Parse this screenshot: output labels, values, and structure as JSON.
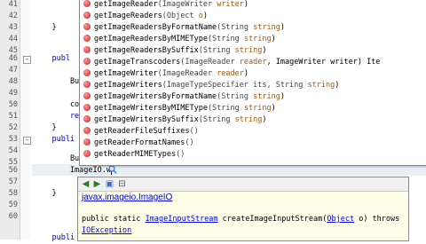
{
  "editor": {
    "line_numbers": [
      "41",
      "42",
      "43",
      "44",
      "45",
      "46",
      "47",
      "48",
      "49",
      "50",
      "51",
      "52",
      "53",
      "54",
      "55",
      "56",
      "57",
      "58",
      "59",
      "60"
    ],
    "code_lines": [
      "",
      "",
      "    }",
      "",
      "",
      "    publ",
      "",
      "        Buff",
      "",
      "        comp",
      "        retu",
      "    }",
      "    publi",
      "",
      "        Buffe",
      "        ImageIO.w",
      "",
      "    }",
      "",
      ""
    ],
    "last_line_text": "    publi"
  },
  "completion": {
    "items": [
      {
        "name": "getImageReader",
        "params": "(ImageWriter ",
        "param_name": "writer",
        "tail": ")"
      },
      {
        "name": "getImageReaders",
        "params": "(Object ",
        "param_name": "o",
        "tail": ")"
      },
      {
        "name": "getImageReadersByFormatName",
        "params": "(String ",
        "param_name": "string",
        "tail": ")"
      },
      {
        "name": "getImageReadersByMIMEType",
        "params": "(String ",
        "param_name": "string",
        "tail": ")"
      },
      {
        "name": "getImageReadersBySuffix",
        "params": "(String ",
        "param_name": "string",
        "tail": ")"
      },
      {
        "name": "getImageTranscoders",
        "params": "(ImageReader ",
        "param_name": "reader",
        "tail": ", ImageWriter writer) Ite"
      },
      {
        "name": "getImageWriter",
        "params": "(ImageReader ",
        "param_name": "reader",
        "tail": ")"
      },
      {
        "name": "getImageWriters",
        "params": "(ImageTypeSpecifier its, String ",
        "param_name": "string",
        "tail": ")"
      },
      {
        "name": "getImageWritersByFormatName",
        "params": "(String ",
        "param_name": "string",
        "tail": ")"
      },
      {
        "name": "getImageWritersByMIMEType",
        "params": "(String ",
        "param_name": "string",
        "tail": ")"
      },
      {
        "name": "getImageWritersBySuffix",
        "params": "(String ",
        "param_name": "string",
        "tail": ")"
      },
      {
        "name": "getReaderFileSuffixes",
        "params": "()",
        "param_name": "",
        "tail": ""
      },
      {
        "name": "getReaderFormatNames",
        "params": "()",
        "param_name": "",
        "tail": ""
      },
      {
        "name": "getReaderMIMETypes",
        "params": "()",
        "param_name": "",
        "tail": ""
      }
    ]
  },
  "javadoc": {
    "class_link": "javax.imageio.ImageIO",
    "sig_prefix": "public static ",
    "sig_type": "ImageInputStream",
    "sig_method": " createImageInputStream(",
    "sig_param_type": "Object",
    "sig_param": " o) throws ",
    "sig_exception": "IOException"
  },
  "colors": {
    "keyword": "#0000cc",
    "param_name": "#a05a14",
    "link": "#0000ee",
    "doc_background": "#fdfde8"
  },
  "icons": [
    "back-arrow-icon",
    "forward-arrow-icon",
    "open-browser-icon",
    "close-doc-icon",
    "search-icon",
    "method-dot-icon",
    "fold-icon"
  ]
}
